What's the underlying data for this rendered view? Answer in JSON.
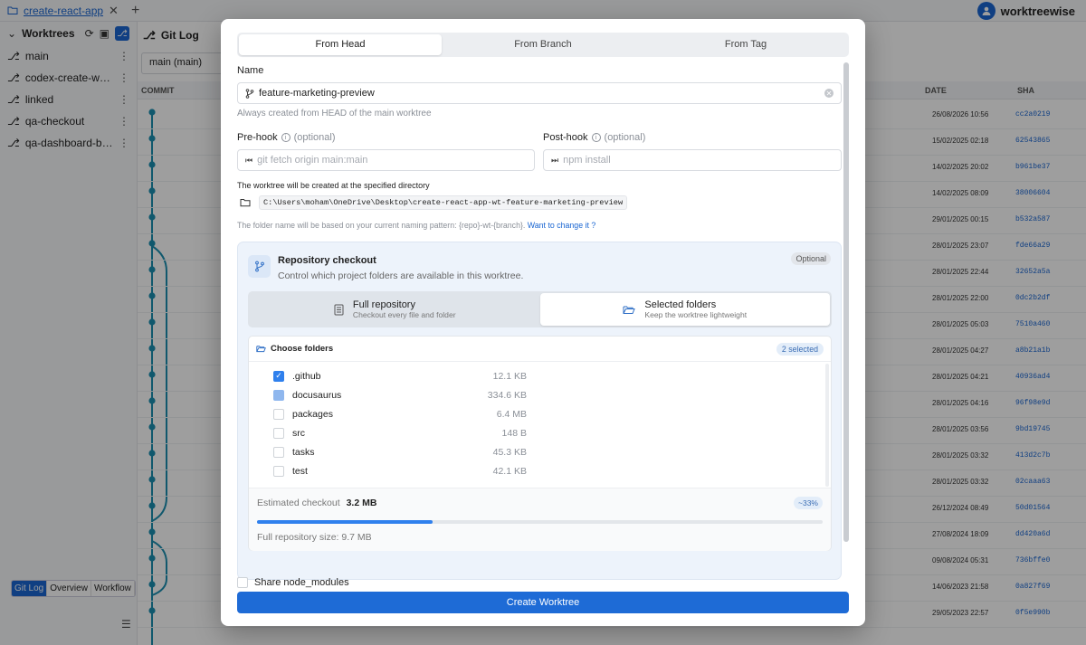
{
  "app": {
    "tab_name": "create-react-app",
    "user_name": "worktreewise"
  },
  "sidebar": {
    "title": "Worktrees",
    "items": [
      {
        "label": "main"
      },
      {
        "label": "codex-create-worktr..."
      },
      {
        "label": "linked"
      },
      {
        "label": "qa-checkout"
      },
      {
        "label": "qa-dashboard-bugfix"
      }
    ],
    "view_tabs": [
      "Git Log",
      "Overview",
      "Workflow"
    ]
  },
  "gitlog": {
    "title": "Git Log",
    "branch_select": "main (main)",
    "columns": {
      "commit": "COMMIT",
      "date": "DATE",
      "sha": "SHA"
    },
    "rows": [
      {
        "date": "26/08/2026 10:56",
        "sha": "cc2a0219"
      },
      {
        "date": "15/02/2025 02:18",
        "sha": "62543865"
      },
      {
        "date": "14/02/2025 20:02",
        "sha": "b961be37"
      },
      {
        "date": "14/02/2025 08:09",
        "sha": "38006604"
      },
      {
        "date": "29/01/2025 00:15",
        "sha": "b532a587"
      },
      {
        "date": "28/01/2025 23:07",
        "sha": "fde66a29"
      },
      {
        "date": "28/01/2025 22:44",
        "sha": "32652a5a"
      },
      {
        "date": "28/01/2025 22:00",
        "sha": "0dc2b2df"
      },
      {
        "date": "28/01/2025 05:03",
        "sha": "7510a460"
      },
      {
        "date": "28/01/2025 04:27",
        "sha": "a8b21a1b"
      },
      {
        "date": "28/01/2025 04:21",
        "sha": "40936ad4"
      },
      {
        "date": "28/01/2025 04:16",
        "sha": "96f98e9d"
      },
      {
        "date": "28/01/2025 03:56",
        "sha": "9bd19745"
      },
      {
        "date": "28/01/2025 03:32",
        "sha": "413d2c7b"
      },
      {
        "date": "28/01/2025 03:32",
        "sha": "02caaa63"
      },
      {
        "date": "26/12/2024 08:49",
        "sha": "50d01564"
      },
      {
        "date": "27/08/2024 18:09",
        "sha": "dd420a6d"
      },
      {
        "date": "09/08/2024 05:31",
        "sha": "736bffe0"
      },
      {
        "date": "14/06/2023 21:58",
        "sha": "0a827f69"
      },
      {
        "date": "29/05/2023 22:57",
        "sha": "0f5e990b"
      }
    ]
  },
  "modal": {
    "mode_tabs": [
      "From Head",
      "From Branch",
      "From Tag"
    ],
    "name_label": "Name",
    "name_value": "feature-marketing-preview",
    "name_hint": "Always created from HEAD of the main worktree",
    "prehook_label": "Pre-hook",
    "prehook_optional": "(optional)",
    "prehook_placeholder": "git fetch origin main:main",
    "posthook_label": "Post-hook",
    "posthook_optional": "(optional)",
    "posthook_placeholder": "npm install",
    "dir_label": "The worktree will be created at the specified directory",
    "dir_path": "C:\\Users\\moham\\OneDrive\\Desktop\\create-react-app-wt-feature-marketing-preview",
    "naming_text": "The folder name will be based on your current naming pattern: {repo}-wt-{branch}.",
    "naming_link": "Want to change it ?",
    "repo": {
      "title": "Repository checkout",
      "subtitle": "Control which project folders are available in this worktree.",
      "badge": "Optional",
      "full_title": "Full repository",
      "full_sub": "Checkout every file and folder",
      "sel_title": "Selected folders",
      "sel_sub": "Keep the worktree lightweight",
      "choose_label": "Choose folders",
      "selected_count": "2 selected",
      "folders": [
        {
          "name": ".github",
          "size": "12.1 KB",
          "state": "checked"
        },
        {
          "name": "docusaurus",
          "size": "334.6 KB",
          "state": "partial"
        },
        {
          "name": "packages",
          "size": "6.4 MB",
          "state": "unchecked"
        },
        {
          "name": "src",
          "size": "148 B",
          "state": "unchecked"
        },
        {
          "name": "tasks",
          "size": "45.3 KB",
          "state": "unchecked"
        },
        {
          "name": "test",
          "size": "42.1 KB",
          "state": "unchecked"
        }
      ],
      "est_label": "Estimated checkout",
      "est_value": "3.2 MB",
      "est_pct": "~33%",
      "est_fraction": 0.31,
      "full_size": "Full repository size: 9.7 MB"
    },
    "share_label": "Share node_modules",
    "create_label": "Create Worktree"
  }
}
